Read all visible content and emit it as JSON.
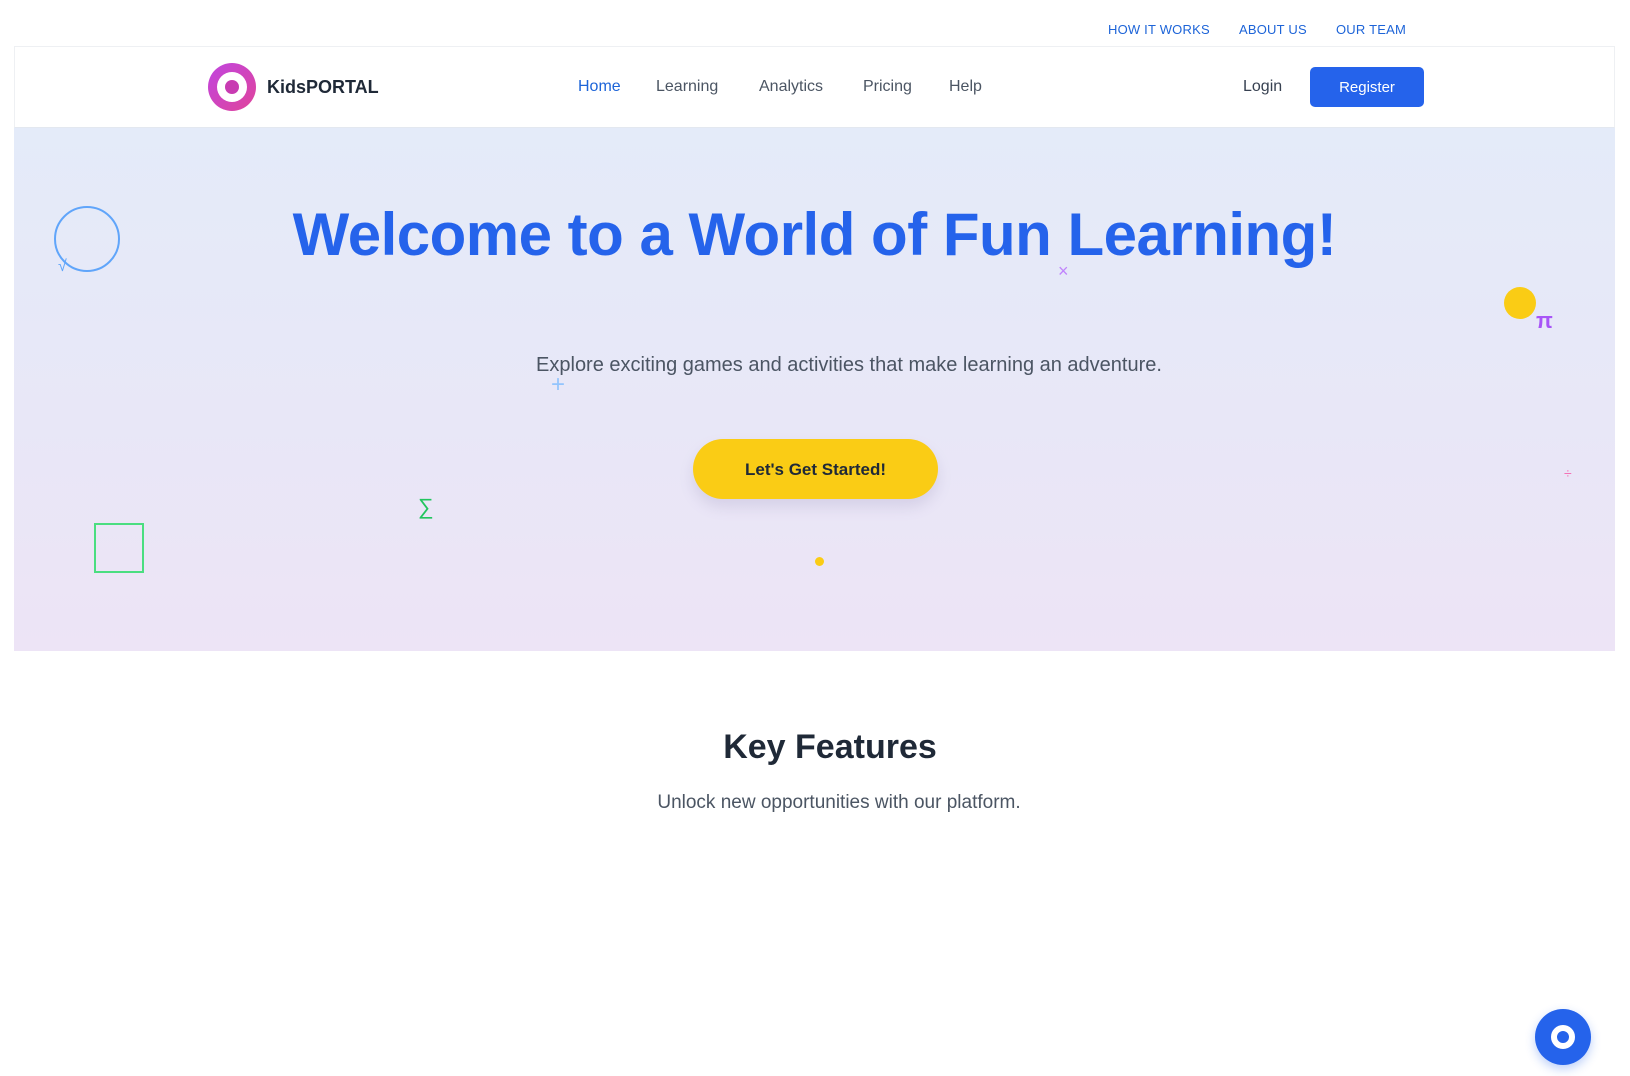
{
  "top_bar": {
    "links": [
      "HOW IT WORKS",
      "ABOUT US",
      "OUR TEAM"
    ]
  },
  "nav": {
    "logo_text": "KidsPORTAL",
    "logo_icon": "target-logo-icon",
    "items": [
      "Home",
      "Learning",
      "Analytics",
      "Pricing",
      "Help"
    ],
    "active_item": "Home",
    "login_label": "Login",
    "register_label": "Register"
  },
  "hero": {
    "title": "Welcome to a World of Fun Learning!",
    "subtitle": "Explore exciting games and activities that make learning an adventure.",
    "cta_label": "Let's Get Started!",
    "decorations": {
      "sqrt": "√",
      "times": "×",
      "pi": "π",
      "plus": "+",
      "sigma": "∑",
      "divide": "÷"
    }
  },
  "features": {
    "title": "Key Features",
    "subtitle": "Unlock new opportunities with our platform."
  },
  "chat": {
    "icon": "chat-icon"
  },
  "colors": {
    "primary": "#2563eb",
    "accent_yellow": "#facc15",
    "logo_gradient_start": "#c045e0",
    "logo_gradient_end": "#e0449a",
    "text_dark": "#1f2937",
    "text_muted": "#4b5563"
  }
}
